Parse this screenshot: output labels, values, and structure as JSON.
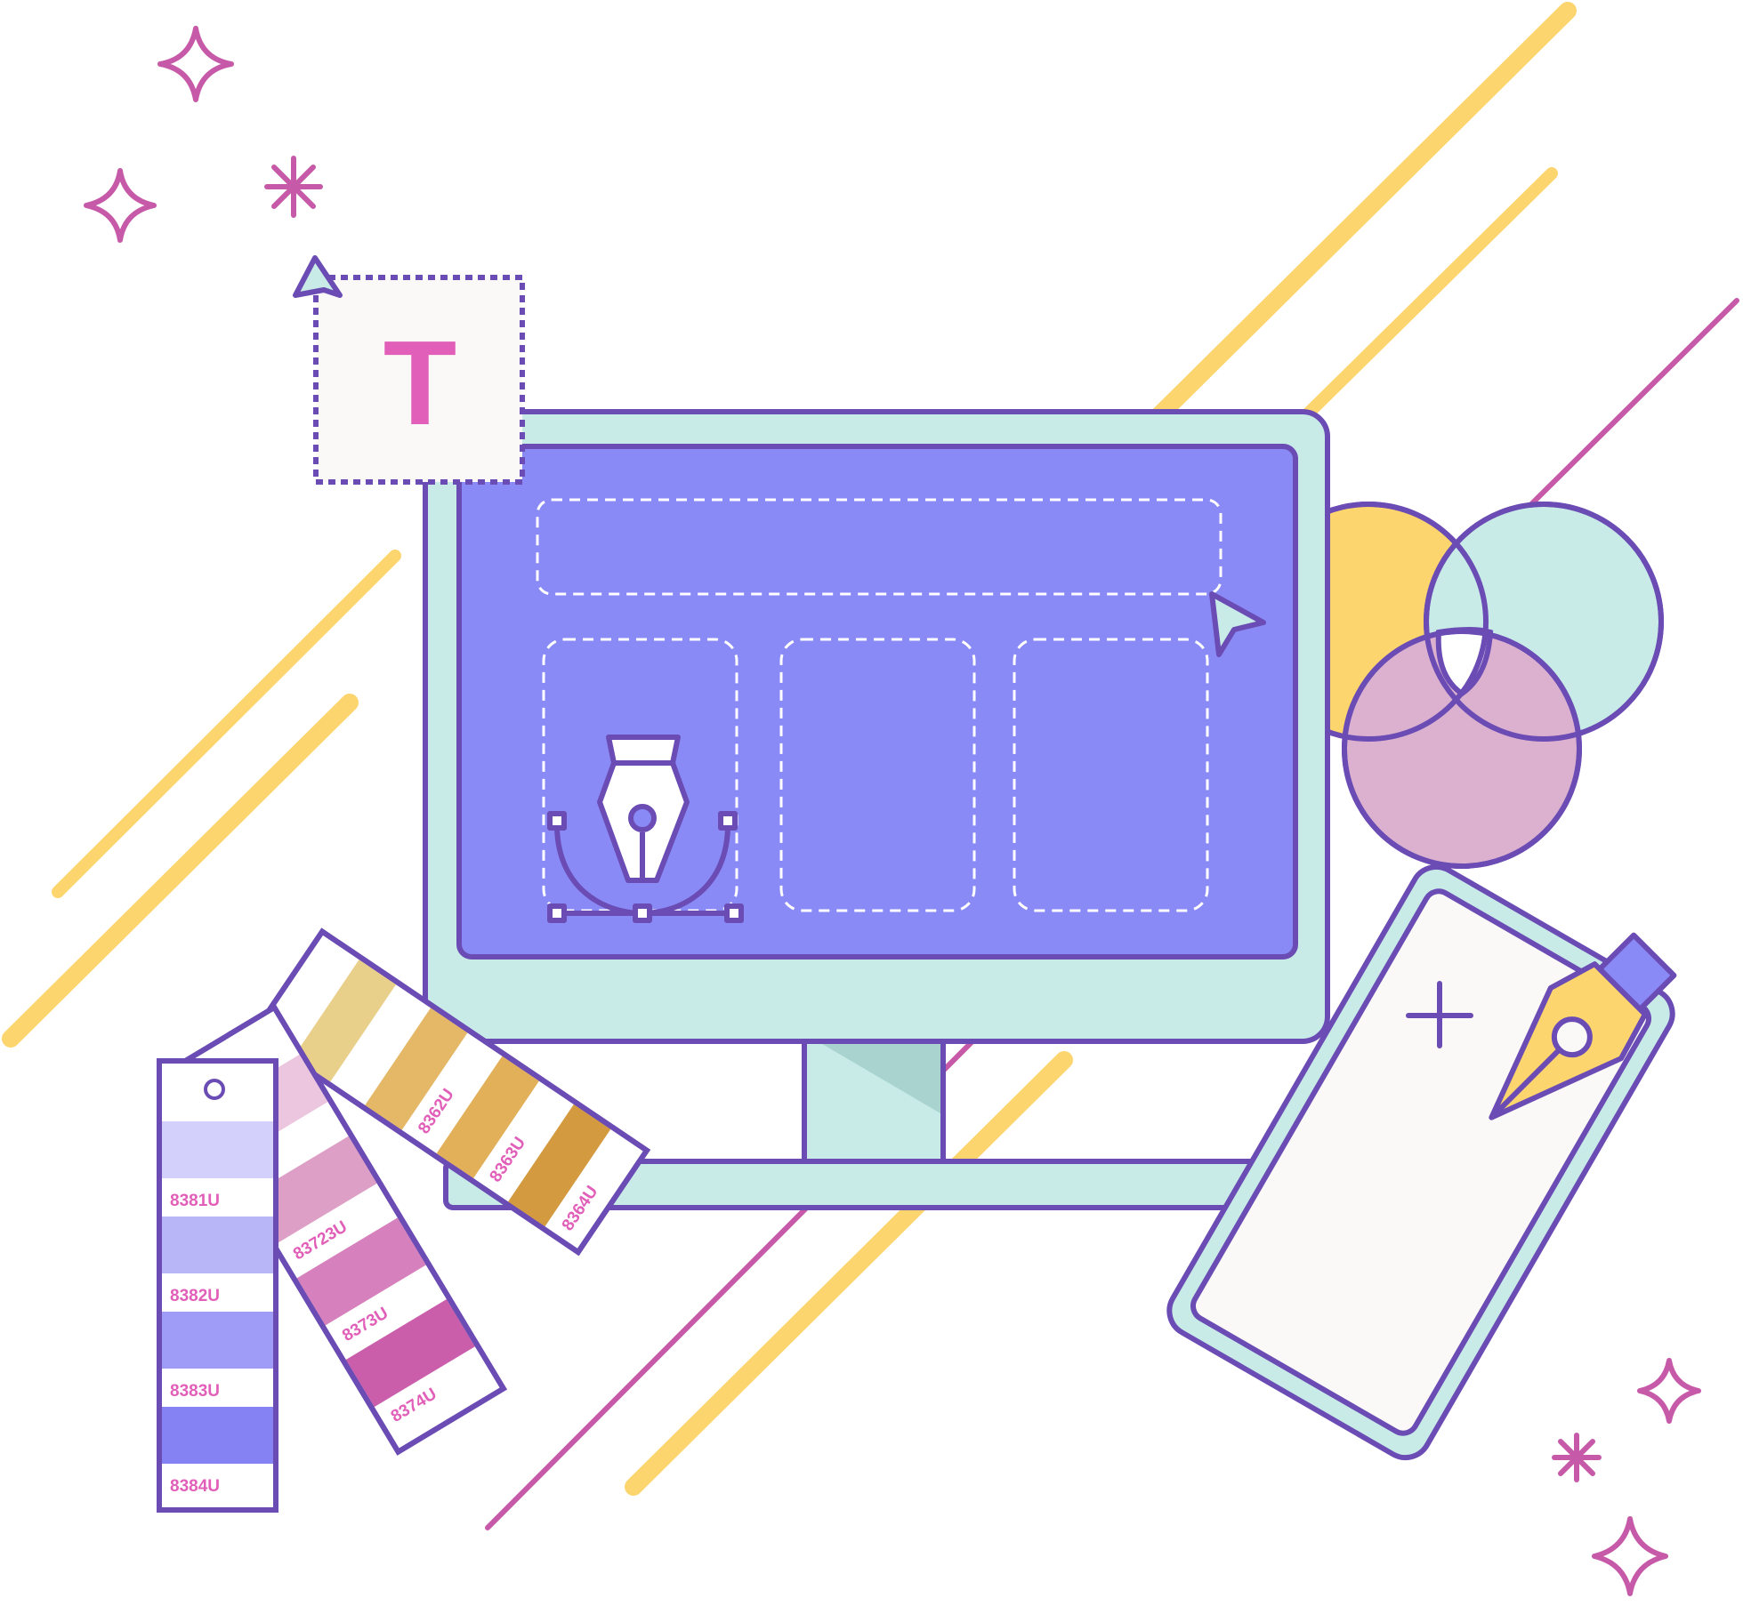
{
  "colors": {
    "outline": "#6a4cb4",
    "screen": "#8a8af6",
    "monitor_body": "#c8ebe8",
    "monitor_shadow": "#a9d3ce",
    "yellow": "#fdd56e",
    "pink": "#e15fb8",
    "magenta_line": "#c65aa9",
    "paper": "#fbf9f7",
    "circle_teal": "#c8ebe8",
    "circle_pink": "#dcb1cf",
    "circle_yellow": "#fdd56e"
  },
  "text_tool": {
    "label": "T"
  },
  "swatch_purple": {
    "icon": "swatch-hole-icon",
    "labels": [
      "8381U",
      "8382U",
      "8383U",
      "8384U"
    ],
    "colors": [
      "#d3d1fb",
      "#b8b6f7",
      "#9e9cf6",
      "#8582f3"
    ]
  },
  "swatch_pink": {
    "labels": [
      "83723U",
      "8373U",
      "8374U"
    ],
    "partial_label": "U",
    "colors": [
      "#ecc6de",
      "#dd9fc6",
      "#d681bd",
      "#cb5eab"
    ]
  },
  "swatch_yellow": {
    "labels": [
      "8362U",
      "8363U",
      "8364U"
    ],
    "colors": [
      "#e8cf8a",
      "#e4b866",
      "#e3b05a",
      "#d39a3f"
    ]
  },
  "icons": {
    "pen_tool": "pen-tool-icon",
    "fountain_pen": "fountain-pen-icon",
    "cursor": "cursor-arrow-icon",
    "plus": "plus-icon",
    "sparkle": "sparkle-icon",
    "asterisk": "asterisk-icon"
  }
}
